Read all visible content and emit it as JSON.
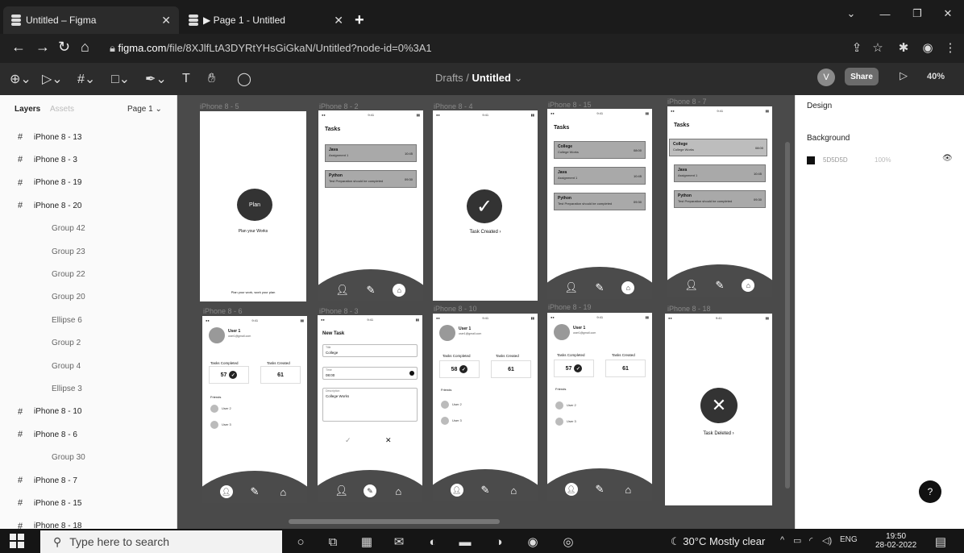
{
  "tabs": [
    {
      "title": "Untitled – Figma"
    },
    {
      "title": "▶ Page 1 - Untitled"
    }
  ],
  "address": {
    "host": "figma.com",
    "path": "/file/8XJlfLtA3DYRtYHsGiGkaN/Untitled?node-id=0%3A1"
  },
  "toolbar": {
    "crumb_folder": "Drafts",
    "crumb_sep": "/",
    "crumb_file": "Untitled",
    "avatar": "V",
    "share": "Share",
    "zoom": "40%"
  },
  "layers": {
    "tab_layers": "Layers",
    "tab_assets": "Assets",
    "page": "Page 1",
    "items": [
      {
        "label": "iPhone 8 - 13",
        "frame": true
      },
      {
        "label": "iPhone 8 - 3",
        "frame": true
      },
      {
        "label": "iPhone 8 - 19",
        "frame": true
      },
      {
        "label": "iPhone 8 - 20",
        "frame": true
      },
      {
        "label": "Group 42",
        "frame": false
      },
      {
        "label": "Group 23",
        "frame": false
      },
      {
        "label": "Group 22",
        "frame": false
      },
      {
        "label": "Group 20",
        "frame": false
      },
      {
        "label": "Ellipse 6",
        "frame": false
      },
      {
        "label": "Group 2",
        "frame": false
      },
      {
        "label": "Group 4",
        "frame": false
      },
      {
        "label": "Ellipse 3",
        "frame": false
      },
      {
        "label": "iPhone 8 - 10",
        "frame": true
      },
      {
        "label": "iPhone 8 - 6",
        "frame": true
      },
      {
        "label": "Group 30",
        "frame": false
      },
      {
        "label": "iPhone 8 - 7",
        "frame": true
      },
      {
        "label": "iPhone 8 - 15",
        "frame": true
      },
      {
        "label": "iPhone 8 - 18",
        "frame": true
      }
    ]
  },
  "frames": {
    "labels": [
      "iPhone 8 - 5",
      "iPhone 8 - 2",
      "iPhone 8 - 4",
      "iPhone 8 - 15",
      "iPhone 8 - 7",
      "iPhone 8 - 6",
      "iPhone 8 - 3",
      "iPhone 8 - 10",
      "iPhone 8 - 19",
      "iPhone 8 - 18"
    ],
    "splash": {
      "logo": "Plan",
      "tagline": "Plan your Works",
      "footer": "Plan your work, work your plan"
    },
    "tasks_title": "Tasks",
    "tasks_a": [
      {
        "name": "Java",
        "sub": "Assignment 1",
        "time": "10:45"
      },
      {
        "name": "Python",
        "sub": "Test Preparation should be completed",
        "time": "09:30"
      }
    ],
    "tasks_b": [
      {
        "name": "College",
        "sub": "College Works",
        "time": "08:00"
      },
      {
        "name": "Java",
        "sub": "Assignment 1",
        "time": "10:45"
      },
      {
        "name": "Python",
        "sub": "Test Preparation should be completed",
        "time": "09:30"
      }
    ],
    "task_created": "Task Created",
    "task_deleted": "Task Deleted",
    "profile": {
      "user": "User 1",
      "email": "user1@gmail.com",
      "completed_label": "Tasks Completed",
      "created_label": "Tasks Created",
      "completed": "57",
      "created": "61",
      "completed_b": "58",
      "friends_label": "Friends",
      "friend1": "User 2",
      "friend2": "User 3"
    },
    "new_task": {
      "title": "New Task",
      "title_label": "Title",
      "title_value": "College",
      "time_label": "Time",
      "time_value": "08:00",
      "desc_label": "Description",
      "desc_value": "College Works"
    }
  },
  "design": {
    "tab": "Design",
    "background_label": "Background",
    "hex": "5D5D5D",
    "opacity": "100%",
    "swatch": "#111111"
  },
  "taskbar": {
    "search_placeholder": "Type here to search",
    "weather": "30°C  Mostly clear",
    "lang": "ENG",
    "time": "19:50",
    "date": "28-02-2022"
  }
}
